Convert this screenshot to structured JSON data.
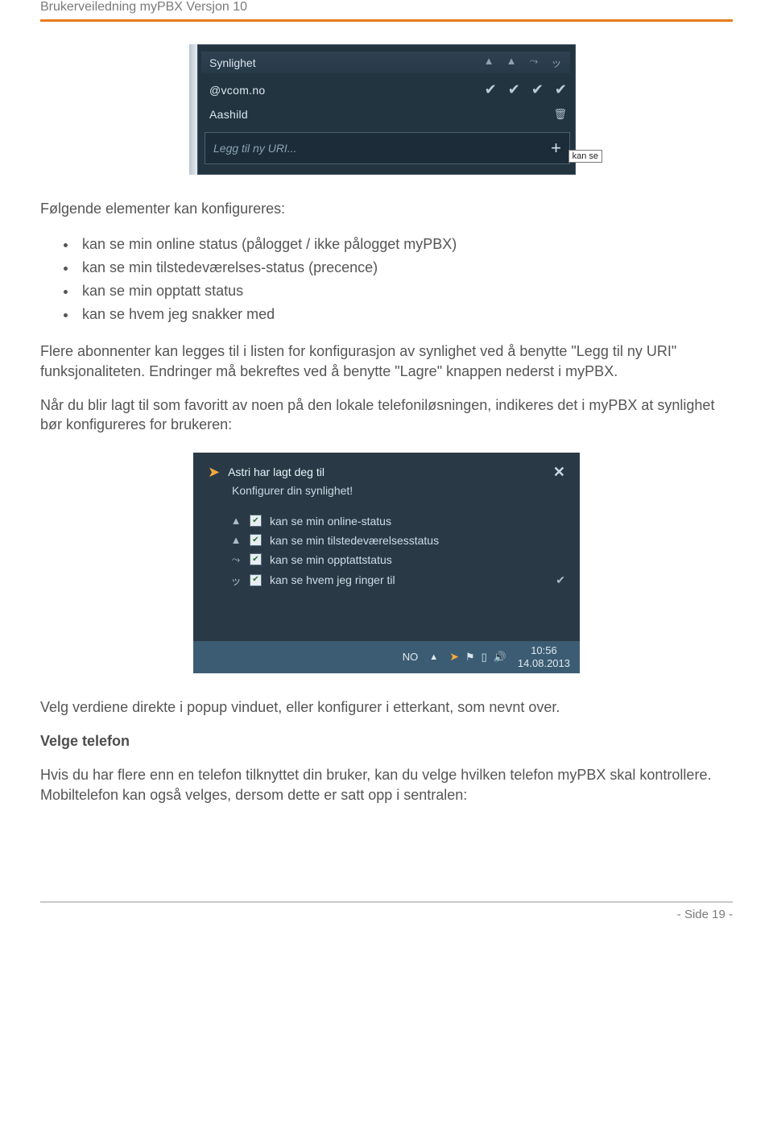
{
  "doc": {
    "header": "Brukerveiledning myPBX Versjon 10",
    "footer": "- Side 19 -"
  },
  "ss1": {
    "title": "Synlighet",
    "rows": [
      {
        "label": "@vcom.no",
        "checks": [
          true,
          true,
          true,
          true
        ],
        "icon": ""
      },
      {
        "label": "Aashild",
        "checks": [],
        "icon": "trash"
      }
    ],
    "input_placeholder": "Legg til ny URI...",
    "tooltip": "kan se"
  },
  "text": {
    "intro": "Følgende elementer kan konfigureres:",
    "bullets": [
      "kan se min online status (pålogget / ikke pålogget myPBX)",
      "kan se min tilstedeværelses-status (precence)",
      "kan se min opptatt status",
      "kan se hvem jeg snakker med"
    ],
    "para2": "Flere abonnenter kan legges til i listen for konfigurasjon av synlighet ved å benytte \"Legg til ny URI\" funksjonaliteten. Endringer må bekreftes ved å benytte \"Lagre\" knappen nederst i myPBX.",
    "para3": "Når du blir lagt til som favoritt av noen på den lokale telefoniløsningen, indikeres det i myPBX at synlighet bør konfigureres for brukeren:",
    "para4": "Velg verdiene direkte i popup vinduet, eller konfigurer i etterkant, som nevnt over.",
    "heading2": "Velge telefon",
    "para5": "Hvis du har flere enn en telefon tilknyttet din bruker, kan du velge hvilken telefon myPBX skal kontrollere. Mobiltelefon kan også velges, dersom dette er satt opp i sentralen:"
  },
  "ss2": {
    "title": "Astri har lagt deg til",
    "subtitle": "Konfigurer din synlighet!",
    "options": [
      "kan se min online-status",
      "kan se min tilstedeværelsesstatus",
      "kan se min opptattstatus",
      "kan se hvem jeg ringer til"
    ],
    "lang": "NO",
    "clock_time": "10:56",
    "clock_date": "14.08.2013"
  }
}
